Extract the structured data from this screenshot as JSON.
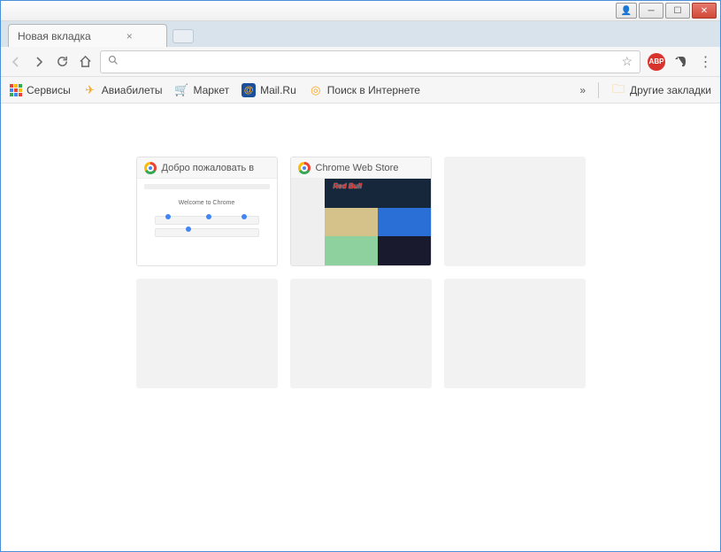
{
  "window": {
    "user_btn": "👤",
    "minimize": "─",
    "maximize": "☐",
    "close": "✕"
  },
  "tab": {
    "title": "Новая вкладка",
    "close": "×"
  },
  "toolbar": {
    "url_value": "",
    "abp_label": "ABP"
  },
  "bookmarks": {
    "apps": "Сервисы",
    "items": [
      {
        "icon": "✈",
        "icon_color": "#f5a623",
        "label": "Авиабилеты"
      },
      {
        "icon": "🛒",
        "icon_color": "#2a6fd6",
        "label": "Маркет"
      },
      {
        "icon": "@",
        "icon_color": "#f5a623",
        "label": "Mail.Ru"
      },
      {
        "icon": "◎",
        "icon_color": "#f5a623",
        "label": "Поиск в Интернете"
      }
    ],
    "overflow": "»",
    "other": "Другие закладки"
  },
  "tiles": [
    {
      "filled": true,
      "title": "Добро пожаловать в",
      "thumb": "welcome",
      "thumb_text": "Welcome to Chrome"
    },
    {
      "filled": true,
      "title": "Chrome Web Store",
      "thumb": "store",
      "thumb_text": "Red Bull"
    },
    {
      "filled": false
    },
    {
      "filled": false
    },
    {
      "filled": false
    },
    {
      "filled": false
    }
  ]
}
